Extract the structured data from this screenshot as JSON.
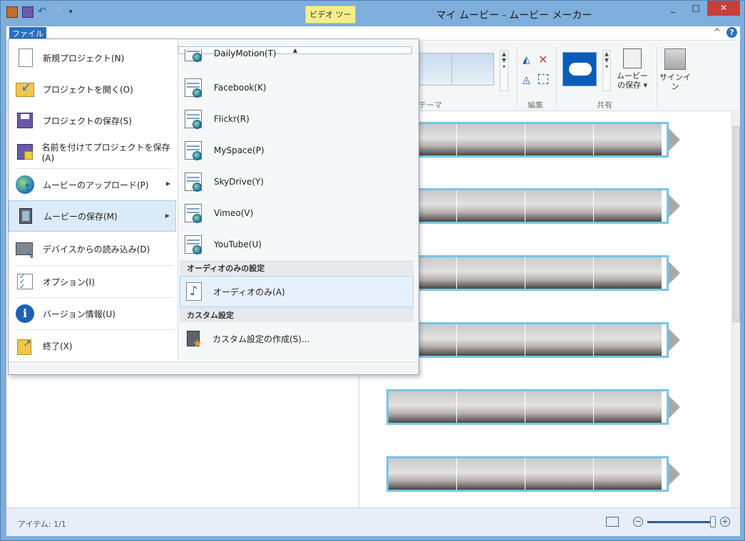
{
  "window": {
    "title": "マイ ムービー - ムービー メーカー",
    "context_tab": "ビデオ ツール",
    "controls": {
      "minimize": "_",
      "maximize": "□",
      "close": "✕"
    }
  },
  "ribbon": {
    "file_tab": "ファイル",
    "help": "?",
    "collapse": "^",
    "groups": {
      "theme_label": "テーマ",
      "edit_label": "編集",
      "share_label": "共有"
    },
    "save_movie_label_1": "ムービー",
    "save_movie_label_2": "の保存 ▾",
    "signin_label": "サインイン"
  },
  "file_menu": {
    "left_items": [
      {
        "label": "新規プロジェクト(N)",
        "icon": "new-document-icon"
      },
      {
        "label": "プロジェクトを開く(O)",
        "icon": "open-folder-icon"
      },
      {
        "label": "プロジェクトの保存(S)",
        "icon": "save-icon"
      },
      {
        "label": "名前を付けてプロジェクトを保存(A)",
        "icon": "save-as-icon"
      },
      {
        "label": "ムービーのアップロード(P)",
        "icon": "upload-globe-icon",
        "submenu": true
      },
      {
        "label": "ムービーの保存(M)",
        "icon": "film-save-icon",
        "submenu": true,
        "active": true
      },
      {
        "label": "デバイスからの読み込み(D)",
        "icon": "camera-import-icon"
      },
      {
        "label": "オプション(I)",
        "icon": "options-checklist-icon"
      },
      {
        "label": "バージョン情報(U)",
        "icon": "info-icon"
      },
      {
        "label": "終了(X)",
        "icon": "exit-icon"
      }
    ],
    "submenu_items": [
      {
        "label": "DailyMotion(T)",
        "icon": "web-document-icon"
      },
      {
        "label": "Facebook(K)",
        "icon": "web-document-icon"
      },
      {
        "label": "Flickr(R)",
        "icon": "web-document-icon"
      },
      {
        "label": "MySpace(P)",
        "icon": "web-document-icon"
      },
      {
        "label": "SkyDrive(Y)",
        "icon": "web-document-icon"
      },
      {
        "label": "Vimeo(V)",
        "icon": "web-document-icon"
      },
      {
        "label": "YouTube(U)",
        "icon": "web-document-icon"
      }
    ],
    "audio_header": "オーディオのみの設定",
    "audio_item": "オーディオのみ(A)",
    "custom_header": "カスタム設定",
    "custom_item": "カスタム設定の作成(S)..."
  },
  "status": {
    "items_text": "アイテム: 1/1",
    "zoom_minus": "−",
    "zoom_plus": "+"
  },
  "storyboard": {
    "clip_count": 6
  }
}
